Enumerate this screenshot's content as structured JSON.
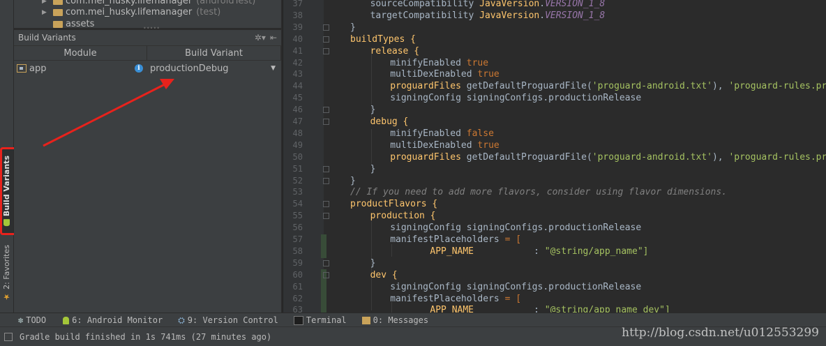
{
  "project_tree": {
    "rows": [
      {
        "label": "com.mei_husky.lifemanager",
        "suffix": "(androidTest)"
      },
      {
        "label": "com.mei_husky.lifemanager",
        "suffix": "(test)"
      },
      {
        "label": "assets",
        "suffix": ""
      }
    ]
  },
  "build_variants": {
    "panel_title": "Build Variants",
    "col_module": "Module",
    "col_variant": "Build Variant",
    "rows": [
      {
        "module": "app",
        "variant": "productionDebug"
      }
    ]
  },
  "left_stripe": {
    "build_variants_tab": "Build Variants",
    "favorites_tab": "2: Favorites"
  },
  "editor": {
    "lines": [
      {
        "n": "37",
        "indent": 4,
        "html": "sourceCompatibility <span class='p2'>JavaVersion</span>.<span class='p'>VERSION_1_8</span>"
      },
      {
        "n": "38"
      },
      {
        "n": "39"
      },
      {
        "n": "40"
      },
      {
        "n": "41"
      },
      {
        "n": "42"
      },
      {
        "n": "43"
      },
      {
        "n": "44"
      },
      {
        "n": "45"
      },
      {
        "n": "46"
      },
      {
        "n": "47"
      },
      {
        "n": "48"
      },
      {
        "n": "49"
      },
      {
        "n": "50"
      },
      {
        "n": "51"
      },
      {
        "n": "52"
      },
      {
        "n": "53"
      },
      {
        "n": "54"
      },
      {
        "n": "55"
      },
      {
        "n": "56"
      },
      {
        "n": "57"
      },
      {
        "n": "58"
      },
      {
        "n": "59"
      },
      {
        "n": "60"
      },
      {
        "n": "61"
      },
      {
        "n": "62"
      },
      {
        "n": "63"
      }
    ],
    "text": {
      "l37a": "sourceCompatibility ",
      "l37b": "JavaVersion",
      "l37c": ".",
      "l37d": "VERSION_1_8",
      "l38a": "targetCompatibility ",
      "l38b": "JavaVersion",
      "l38c": ".",
      "l38d": "VERSION_1_8",
      "l39": "}",
      "l40": "buildTypes {",
      "l41": "release {",
      "l42a": "minifyEnabled ",
      "l42b": "true",
      "l43a": "multiDexEnabled ",
      "l43b": "true",
      "l44a": "proguardFiles ",
      "l44b": "getDefaultProguardFile(",
      "l44c": "'proguard-android.txt'",
      "l44d": "), ",
      "l44e": "'proguard-rules.pro'",
      "l45": "signingConfig signingConfigs.productionRelease",
      "l46": "}",
      "l47": "debug {",
      "l48a": "minifyEnabled ",
      "l48b": "false",
      "l49a": "multiDexEnabled ",
      "l49b": "true",
      "l50a": "proguardFiles ",
      "l50b": "getDefaultProguardFile(",
      "l50c": "'proguard-android.txt'",
      "l50d": "), ",
      "l50e": "'proguard-rules.pro'",
      "l51": "}",
      "l52": "}",
      "l53": "// If you need to add more flavors, consider using flavor dimensions.",
      "l54": "productFlavors {",
      "l55": "production {",
      "l56": "signingConfig signingConfigs.productionRelease",
      "l57a": "manifestPlaceholders ",
      "l57b": "= [",
      "l58a": "APP_NAME           ",
      "l58b": ": ",
      "l58c": "\"@string/app_name\"]",
      "l59": "}",
      "l60": "dev {",
      "l61": "signingConfig signingConfigs.productionRelease",
      "l62a": "manifestPlaceholders ",
      "l62b": "= [",
      "l63a": "APP_NAME           ",
      "l63b": ": ",
      "l63c": "\"@string/app_name_dev\"]"
    }
  },
  "tool_windows": {
    "todo": "TODO",
    "android_monitor": "6: Android Monitor",
    "version_control": "9: Version Control",
    "terminal": "Terminal",
    "messages": "0: Messages"
  },
  "status": {
    "message": "Gradle build finished in 1s 741ms (27 minutes ago)",
    "watermark": "http://blog.csdn.net/u012553299"
  },
  "colors": {
    "annotation_red": "#e8221c",
    "keyword": "#cc7832",
    "string": "#a5c261",
    "constant": "#9876aa",
    "method": "#ffc66d",
    "comment": "#808080"
  }
}
